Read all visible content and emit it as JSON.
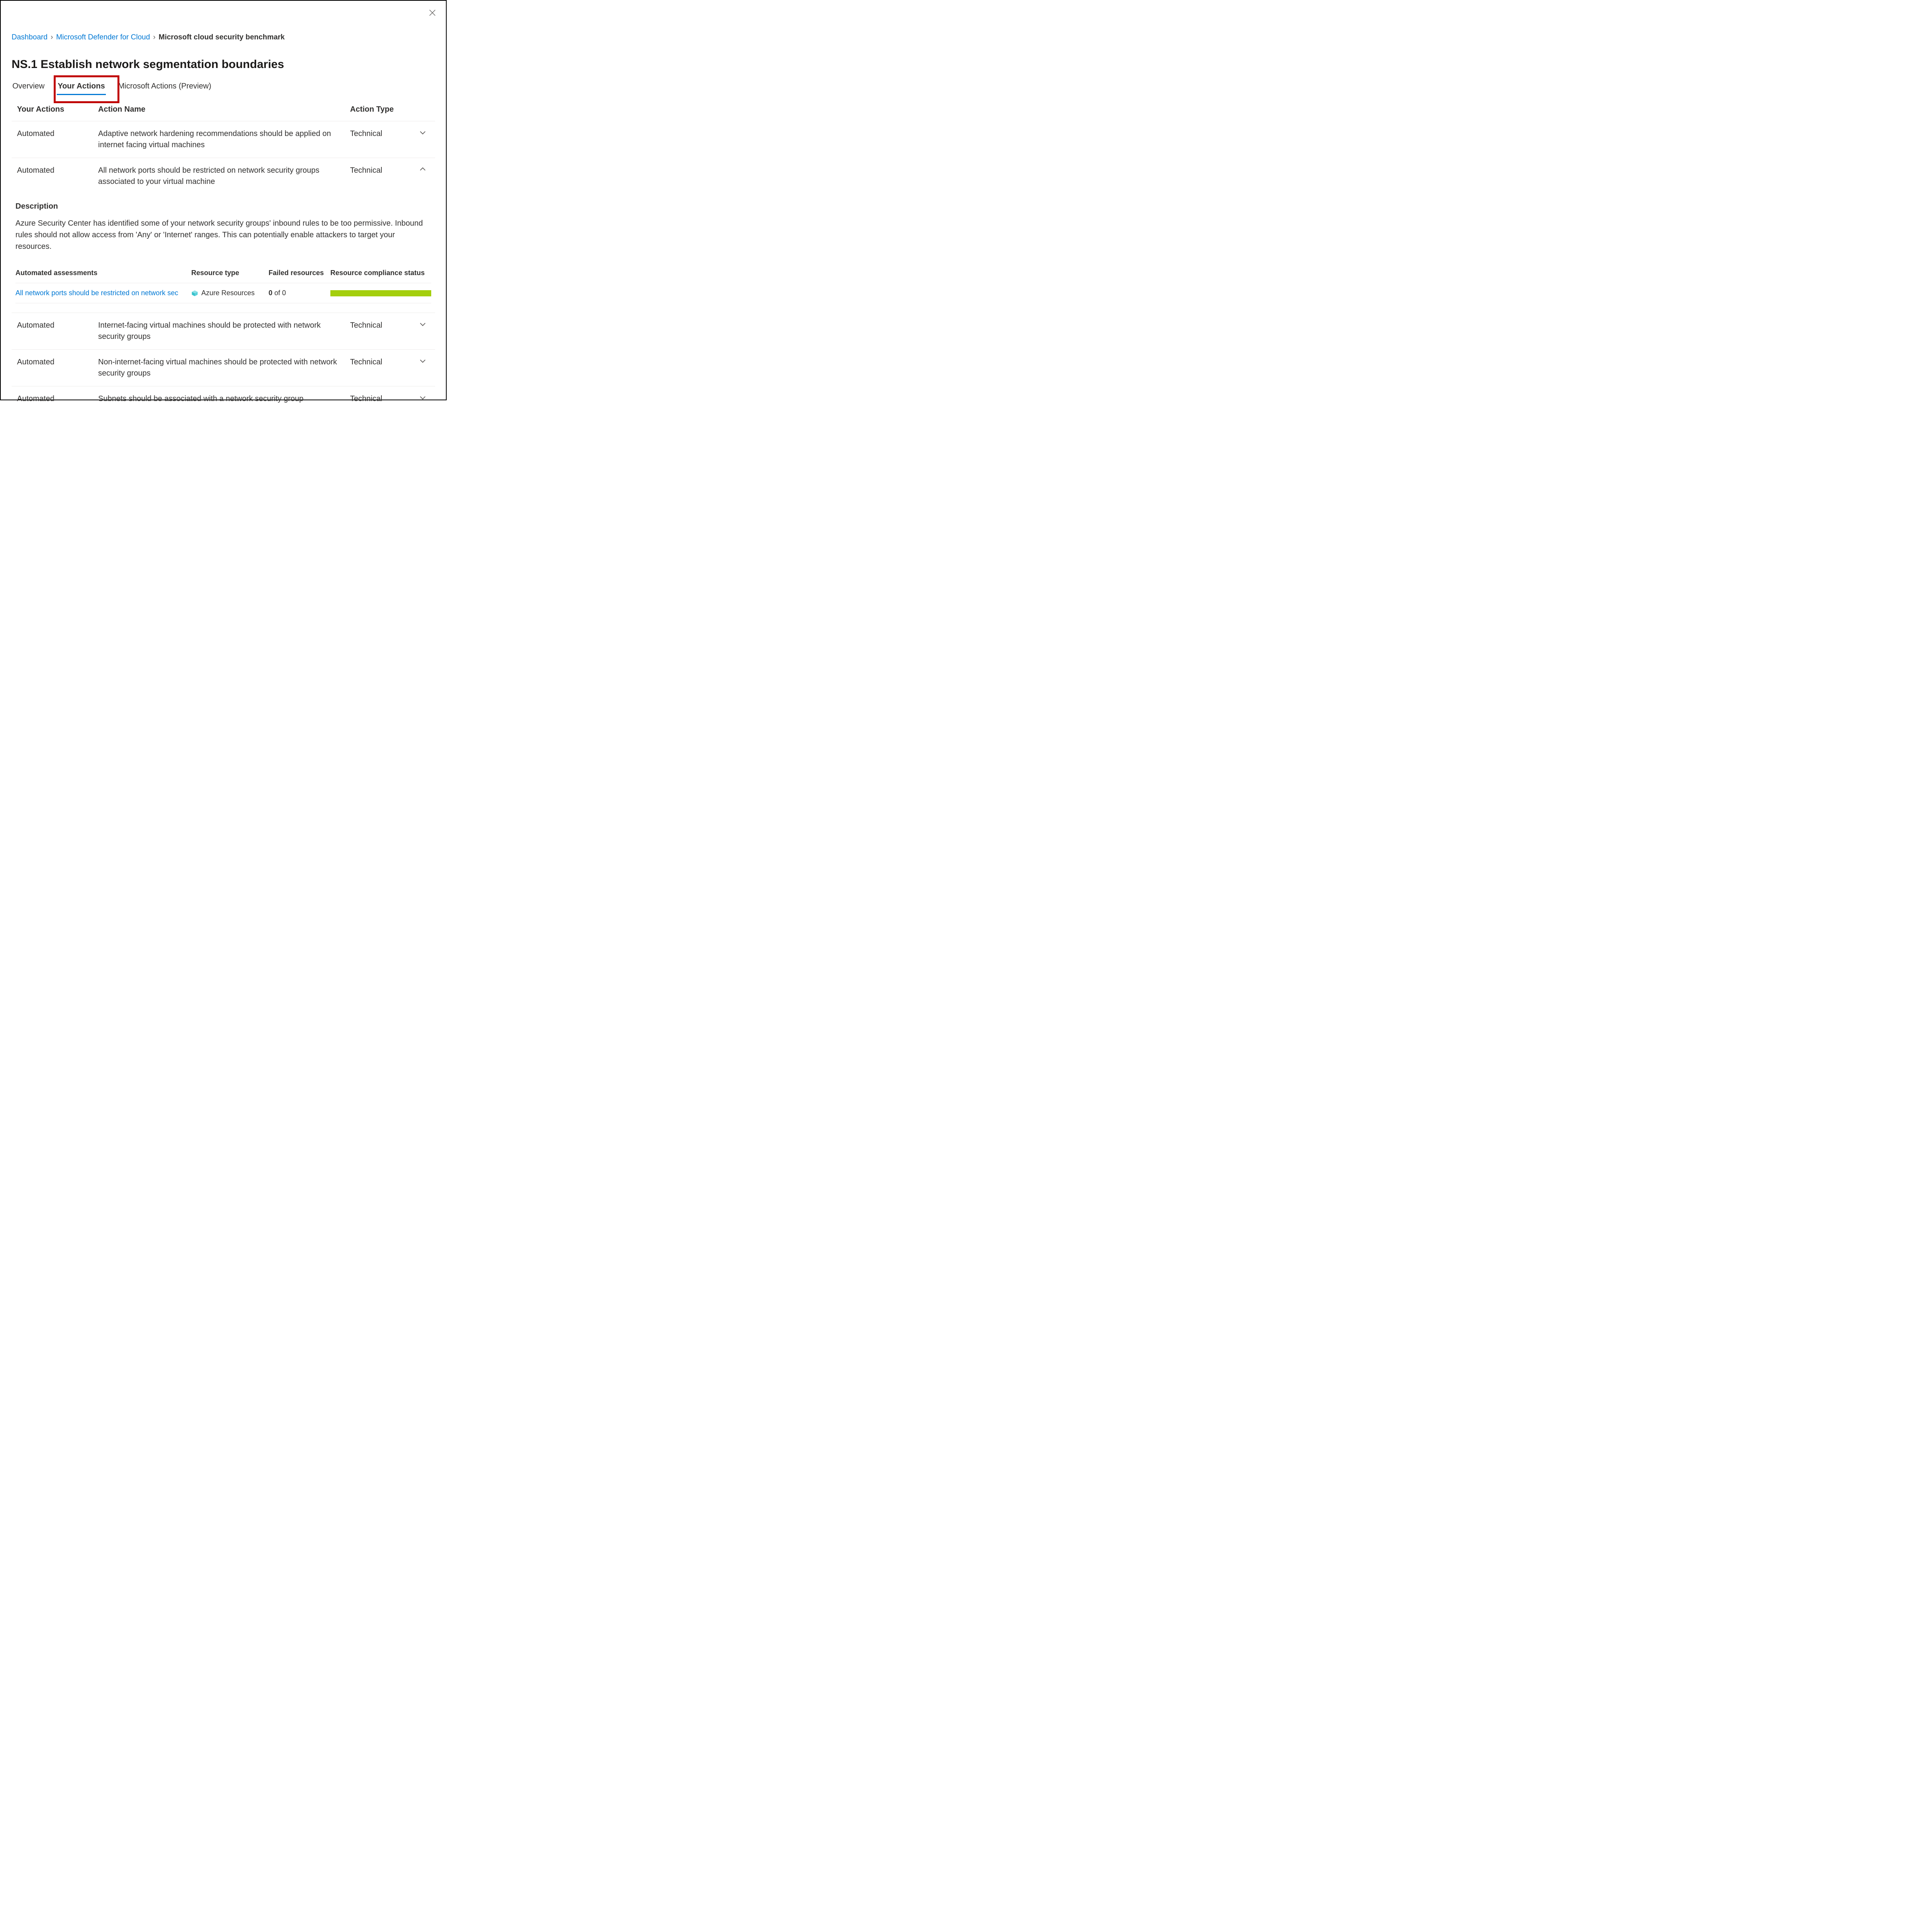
{
  "breadcrumbs": {
    "dashboard": "Dashboard",
    "defender": "Microsoft Defender for Cloud",
    "current": "Microsoft cloud security benchmark"
  },
  "title": "NS.1 Establish network segmentation boundaries",
  "tabs": {
    "overview": "Overview",
    "your_actions": "Your Actions",
    "ms_actions": "Microsoft Actions (Preview)"
  },
  "columns": {
    "your_actions": "Your Actions",
    "action_name": "Action Name",
    "action_type": "Action Type"
  },
  "rows": [
    {
      "ya": "Automated",
      "an": "Adaptive network hardening recommendations should be applied on internet facing virtual machines",
      "at": "Technical",
      "open": false
    },
    {
      "ya": "Automated",
      "an": "All network ports should be restricted on network security groups associated to your virtual machine",
      "at": "Technical",
      "open": true
    },
    {
      "ya": "Automated",
      "an": "Internet-facing virtual machines should be protected with network security groups",
      "at": "Technical",
      "open": false
    },
    {
      "ya": "Automated",
      "an": "Non-internet-facing virtual machines should be protected with network security groups",
      "at": "Technical",
      "open": false
    },
    {
      "ya": "Automated",
      "an": "Subnets should be associated with a network security group",
      "at": "Technical",
      "open": false
    }
  ],
  "detail": {
    "heading": "Description",
    "body": "Azure Security Center has identified some of your network security groups' inbound rules to be too permissive. Inbound rules should not allow access from 'Any' or 'Internet' ranges. This can potentially enable attackers to target your resources."
  },
  "assessments": {
    "headers": {
      "name": "Automated assessments",
      "rtype": "Resource type",
      "failed": "Failed resources",
      "status": "Resource compliance status"
    },
    "row": {
      "name": "All network ports should be restricted on network sec",
      "rtype": "Azure Resources",
      "failed_bold": "0",
      "failed_rest": " of 0"
    }
  }
}
